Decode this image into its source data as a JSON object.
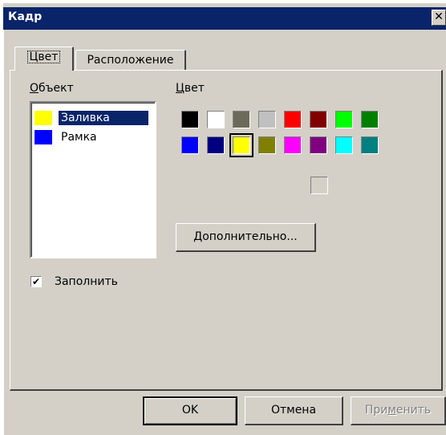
{
  "window": {
    "title": "Кадр",
    "close_glyph": "✕"
  },
  "tabs": [
    {
      "label": "Цвет",
      "active": true
    },
    {
      "label": "Расположение",
      "active": false
    }
  ],
  "object_panel": {
    "label_prefix": "",
    "label_underlined": "О",
    "label_rest": "бъект",
    "items": [
      {
        "label": "Заливка",
        "swatch": "#ffff00",
        "selected": true
      },
      {
        "label": "Рамка",
        "swatch": "#0000ff",
        "selected": false
      }
    ]
  },
  "color_panel": {
    "label_prefix": "",
    "label_underlined": "Ц",
    "label_rest": "вет",
    "palette": [
      "#000000",
      "#ffffff",
      "#6b6b59",
      "#c0c0c0",
      "#ff0000",
      "#800000",
      "#00ff00",
      "#008000",
      "#0000ff",
      "#000080",
      "#ffff00",
      "#808000",
      "#ff00ff",
      "#800080",
      "#00ffff",
      "#008080"
    ],
    "selected_index": 10,
    "custom_color": "#d4d0c8",
    "more_button": "Дополнительно..."
  },
  "fill_checkbox": {
    "label": "Заполнить",
    "checked": true,
    "check_glyph": "✔"
  },
  "buttons": {
    "ok": "OK",
    "cancel": "Отмена",
    "apply_prefix": "При",
    "apply_underlined": "м",
    "apply_rest": "енить"
  }
}
